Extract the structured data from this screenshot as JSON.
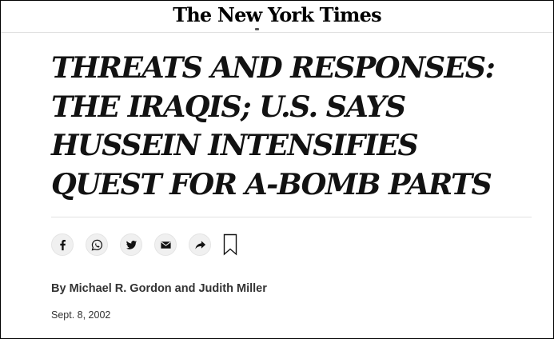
{
  "masthead": {
    "logo_text": "The New York Times"
  },
  "article": {
    "headline": "THREATS AND RESPONSES: THE IRAQIS; U.S. SAYS HUSSEIN INTENSIFIES QUEST FOR A-BOMB PARTS",
    "byline": "By Michael R. Gordon and Judith Miller",
    "date": "Sept. 8, 2002"
  },
  "share_tools": {
    "icons": [
      "facebook-icon",
      "whatsapp-icon",
      "twitter-icon",
      "email-icon",
      "share-icon",
      "bookmark-icon"
    ]
  },
  "colors": {
    "text": "#121212",
    "icon_bg": "#f0f0f0",
    "rule": "#e2e2e2"
  }
}
